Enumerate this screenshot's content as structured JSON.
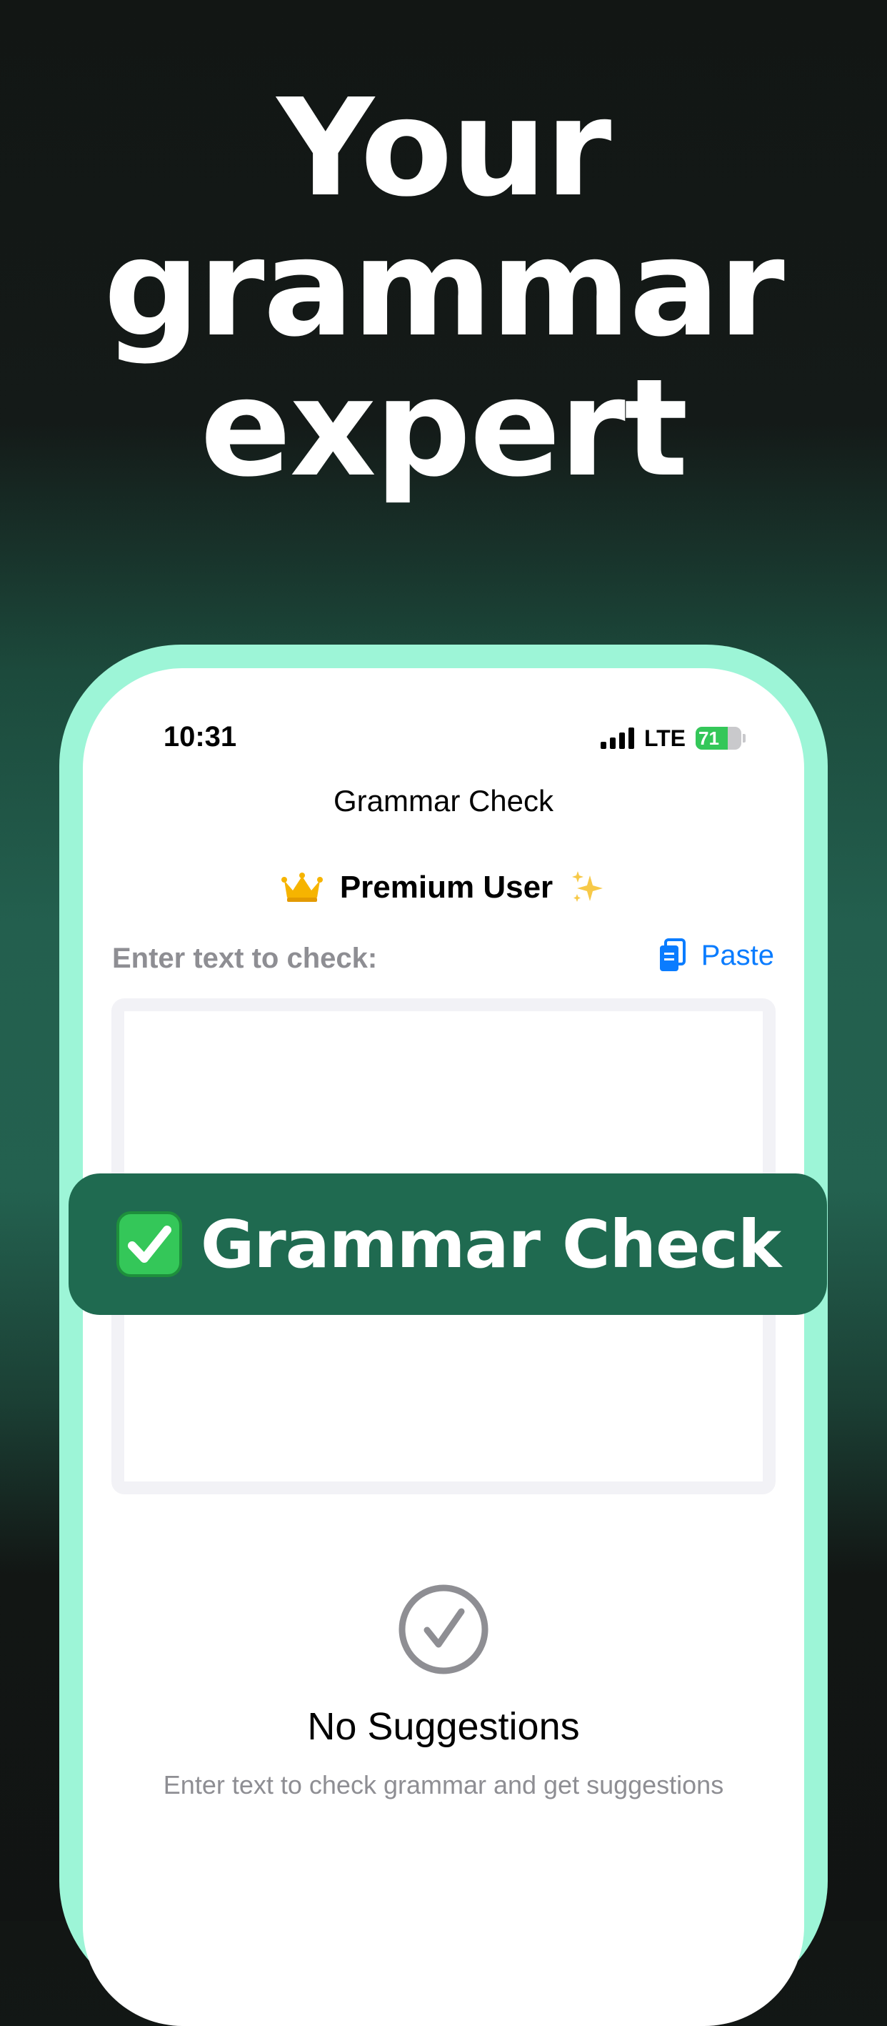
{
  "headline": {
    "line1": "Your",
    "line2": "grammar",
    "line3": "expert"
  },
  "status_bar": {
    "time": "10:31",
    "network": "LTE",
    "battery_percent": 71,
    "battery_label": "71"
  },
  "nav": {
    "title": "Grammar Check"
  },
  "premium": {
    "label": "Premium User",
    "leading_icon": "crown-icon",
    "trailing_icon": "sparkles-icon"
  },
  "input": {
    "label": "Enter text to check:",
    "paste_label": "Paste",
    "paste_icon": "clipboard-icon",
    "value": ""
  },
  "empty_state": {
    "icon": "check-circle-icon",
    "title": "No Suggestions",
    "subtitle": "Enter text to check grammar and get suggestions"
  },
  "banner": {
    "icon": "green-check-icon",
    "text": "Grammar Check"
  },
  "colors": {
    "accent_mint": "#9df5d7",
    "banner_green": "#1f6a50",
    "link_blue": "#0a7cff",
    "secondary_gray": "#8e8e93",
    "battery_green": "#34c759"
  }
}
